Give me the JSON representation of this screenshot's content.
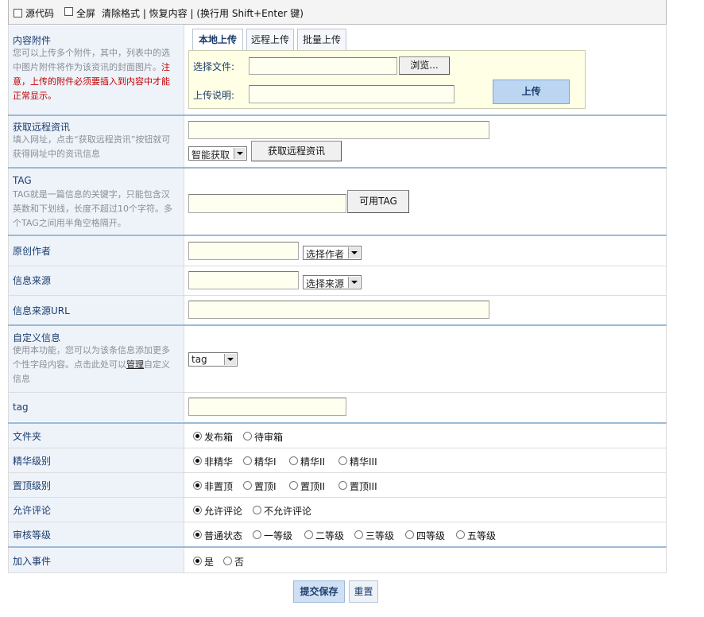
{
  "toolbar": {
    "source_label": "源代码",
    "fullscreen_label": "全屏",
    "rest_text": "清除格式 | 恢复内容 | (换行用 Shift+Enter 键)"
  },
  "attachment": {
    "label": "内容附件",
    "desc_pre": "您可以上传多个附件，其中，列表中的选中图片附件将作为该资讯的封面图片。",
    "desc_red": "注意，上传的附件必须要插入到内容中才能正常显示。",
    "tabs": [
      "本地上传",
      "远程上传",
      "批量上传"
    ],
    "file_label": "选择文件:",
    "browse_label": "浏览...",
    "note_label": "上传说明:",
    "upload_label": "上传"
  },
  "remote": {
    "label": "获取远程资讯",
    "desc": "填入网址，点击“获取远程资讯”按钮就可获得网址中的资讯信息",
    "select_value": "智能获取",
    "button_label": "获取远程资讯"
  },
  "tag": {
    "label": "TAG",
    "desc": "TAG就是一篇信息的关键字，只能包含汉英数和下划线，长度不超过10个字符。多个TAG之间用半角空格隔开。",
    "button_label": "可用TAG"
  },
  "author": {
    "label": "原创作者",
    "select_value": "选择作者"
  },
  "source": {
    "label": "信息来源",
    "select_value": "选择来源"
  },
  "source_url": {
    "label": "信息来源URL"
  },
  "custom": {
    "label": "自定义信息",
    "desc_pre": "使用本功能，您可以为该条信息添加更多个性字段内容。点击此处可以",
    "desc_link": "管理",
    "desc_post": "自定义信息",
    "select_value": "tag"
  },
  "tag_field": {
    "label": "tag"
  },
  "folder": {
    "label": "文件夹",
    "options": [
      "发布箱",
      "待审箱"
    ],
    "selected": 0
  },
  "elite": {
    "label": "精华级别",
    "options": [
      "非精华",
      "精华I",
      "精华II",
      "精华III"
    ],
    "selected": 0
  },
  "top": {
    "label": "置顶级别",
    "options": [
      "非置顶",
      "置顶I",
      "置顶II",
      "置顶III"
    ],
    "selected": 0
  },
  "comment": {
    "label": "允许评论",
    "options": [
      "允许评论",
      "不允许评论"
    ],
    "selected": 0
  },
  "audit": {
    "label": "审核等级",
    "options": [
      "普通状态",
      "一等级",
      "二等级",
      "三等级",
      "四等级",
      "五等级"
    ],
    "selected": 0
  },
  "event": {
    "label": "加入事件",
    "options": [
      "是",
      "否"
    ],
    "selected": 0
  },
  "footer": {
    "submit_label": "提交保存",
    "reset_label": "重置"
  }
}
